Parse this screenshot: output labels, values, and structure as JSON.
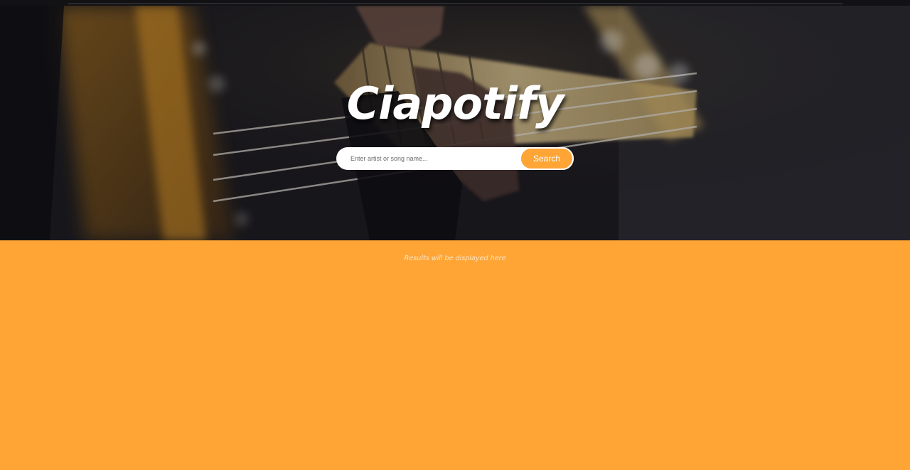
{
  "app": {
    "title": "Ciapotify"
  },
  "search": {
    "placeholder": "Enter artist or song name...",
    "value": "",
    "button_label": "Search"
  },
  "results": {
    "placeholder_text": "Results will be displayed here"
  },
  "colors": {
    "accent": "#fea535",
    "hero_dark": "#1b1a1f",
    "text_light": "#ffffff"
  }
}
